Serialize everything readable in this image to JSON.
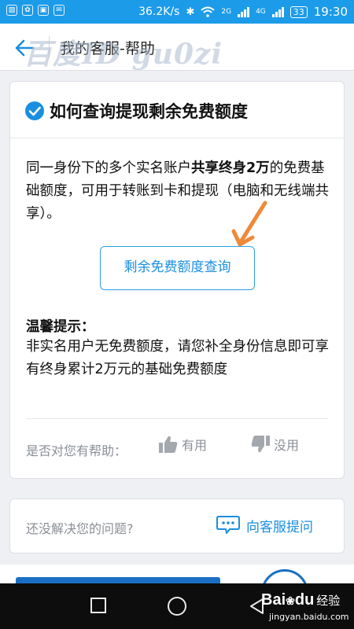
{
  "status_bar": {
    "apps": [
      "▧",
      "✿",
      "▣",
      "✉"
    ],
    "net_speed": "36.2K/s",
    "bluetooth_icon": "bluetooth-icon",
    "wifi_icon": "wifi-icon",
    "sim1_label": "2G",
    "sim2_label": "4G",
    "battery": "33",
    "time": "19:30"
  },
  "header": {
    "title": "我的客服-帮助",
    "watermark": "百度ID gu0zi"
  },
  "article": {
    "title": "如何查询提现剩余免费额度",
    "answer_part1": "同一身份下的多个实名账户",
    "answer_bold": "共享终身2万",
    "answer_part2": "的免费基础额度，可用于转账到卡和提现（电脑和无线端共享）。",
    "query_button": "剩余免费额度查询",
    "tip_title": "温馨提示：",
    "tip_text": "非实名用户无免费额度，请您补全身份信息即可享有终身累计2万元的基础免费额度"
  },
  "feedback": {
    "label": "是否对您有帮助：",
    "useful": "有用",
    "useless": "没用"
  },
  "ask": {
    "label": "还没解决您的问题?",
    "button": "向客服提问"
  },
  "nav": {
    "logo_text": "Bai",
    "logo_text2": "du",
    "logo_cn": "经验",
    "url": "jingyan.baidu.com"
  },
  "colors": {
    "status_bar": "#1c9be8",
    "accent": "#1a8fe0",
    "arrow": "#f0893a",
    "muted": "#8a8f96"
  }
}
